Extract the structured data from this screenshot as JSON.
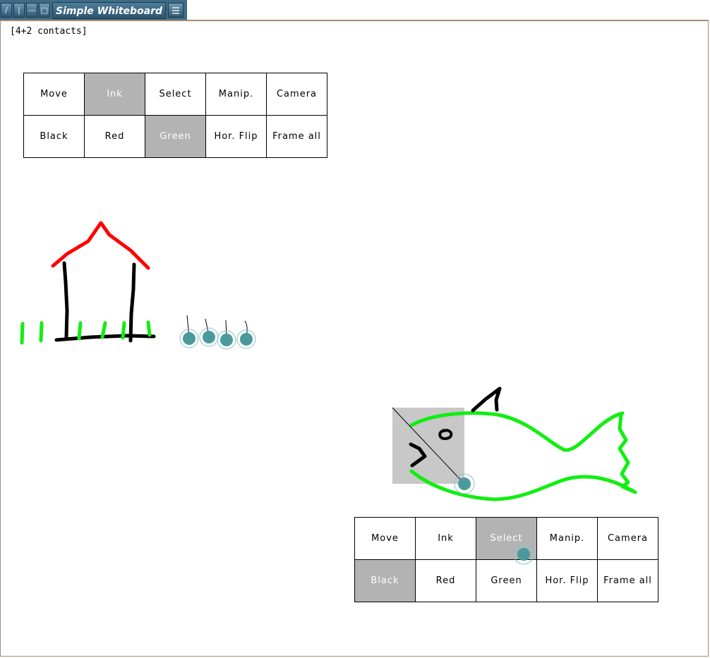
{
  "window": {
    "title": "Simple Whiteboard",
    "buttons": [
      "/",
      "|",
      "—",
      "□"
    ],
    "menu_icon": "menu-lines-icon"
  },
  "status": {
    "contacts": "[4+2 contacts]"
  },
  "menu1": {
    "row1": [
      "Move",
      "Ink",
      "Select",
      "Manip.",
      "Camera"
    ],
    "row2": [
      "Black",
      "Red",
      "Green",
      "Hor. Flip",
      "Frame all"
    ]
  },
  "menu2": {
    "row1": [
      "Move",
      "Ink",
      "Select",
      "Manip.",
      "Camera"
    ],
    "row2": [
      "Black",
      "Red",
      "Green",
      "Hor. Flip",
      "Frame all"
    ]
  },
  "colors": {
    "ink_black": "#000000",
    "ink_red": "#ff0000",
    "ink_green": "#11ee11",
    "contact": "#4a9a9c",
    "selection": "#c8c8c8",
    "highlight": "#b3b3b3"
  }
}
